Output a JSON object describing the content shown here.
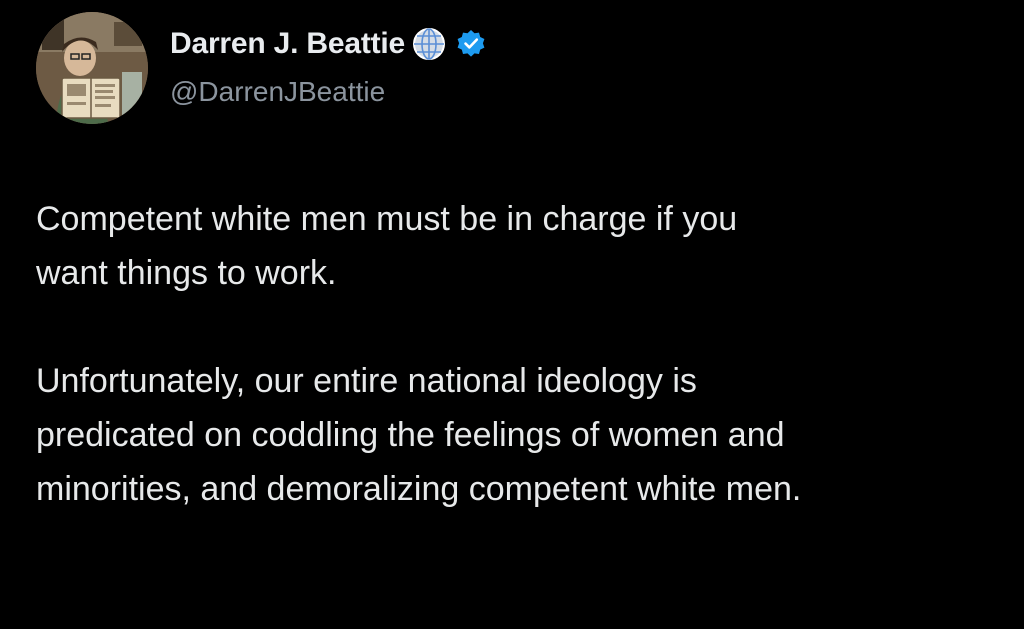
{
  "tweet": {
    "author": {
      "display_name": "Darren J. Beattie",
      "handle": "@DarrenJBeattie",
      "avatar_icon": "avatar-portrait",
      "badges": [
        "globe-icon",
        "verified-icon"
      ],
      "verified_color": "#1d9bf0"
    },
    "paragraphs": [
      "Competent white men must be in charge if you\nwant things to work.",
      "Unfortunately, our entire national ideology is\npredicated on coddling the feelings of women and\nminorities, and demoralizing competent white men."
    ]
  }
}
